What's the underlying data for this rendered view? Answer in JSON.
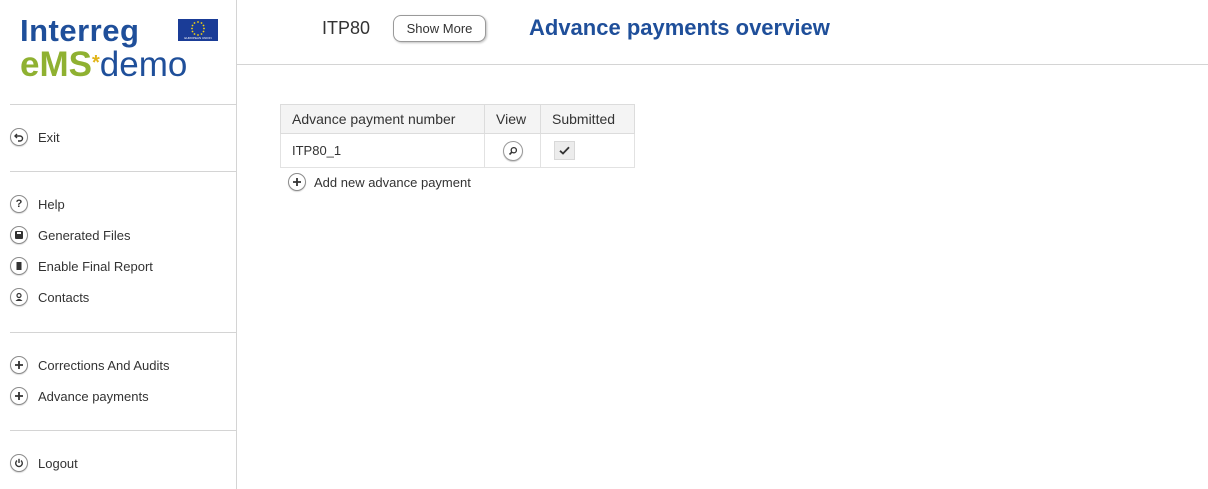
{
  "logo": {
    "line1": "Interreg",
    "ems": "eMS",
    "star": "*",
    "demo": "demo",
    "eu_caption": "EUROPEAN UNION"
  },
  "colors": {
    "brand_blue": "#1f4f9a",
    "ems_green": "#8fb131",
    "star_yellow": "#e2b417",
    "eu_flag_blue": "#1a3c97"
  },
  "sidebar": {
    "groups": [
      [
        {
          "label": "Exit",
          "icon": "undo-arrow-icon"
        }
      ],
      [
        {
          "label": "Help",
          "icon": "question-icon"
        },
        {
          "label": "Generated Files",
          "icon": "save-icon"
        },
        {
          "label": "Enable Final Report",
          "icon": "book-icon"
        },
        {
          "label": "Contacts",
          "icon": "user-icon"
        }
      ],
      [
        {
          "label": "Corrections And Audits",
          "icon": "plus-icon"
        },
        {
          "label": "Advance payments",
          "icon": "plus-icon"
        }
      ],
      [
        {
          "label": "Logout",
          "icon": "power-icon"
        }
      ]
    ]
  },
  "header": {
    "project_code": "ITP80",
    "show_more_label": "Show More",
    "page_title": "Advance payments overview"
  },
  "table": {
    "columns": [
      "Advance payment number",
      "View",
      "Submitted"
    ],
    "rows": [
      {
        "number": "ITP80_1",
        "view_icon": "magnifier-icon",
        "submitted": true
      }
    ]
  },
  "add_link": {
    "label": "Add new advance payment",
    "icon": "plus-icon"
  }
}
